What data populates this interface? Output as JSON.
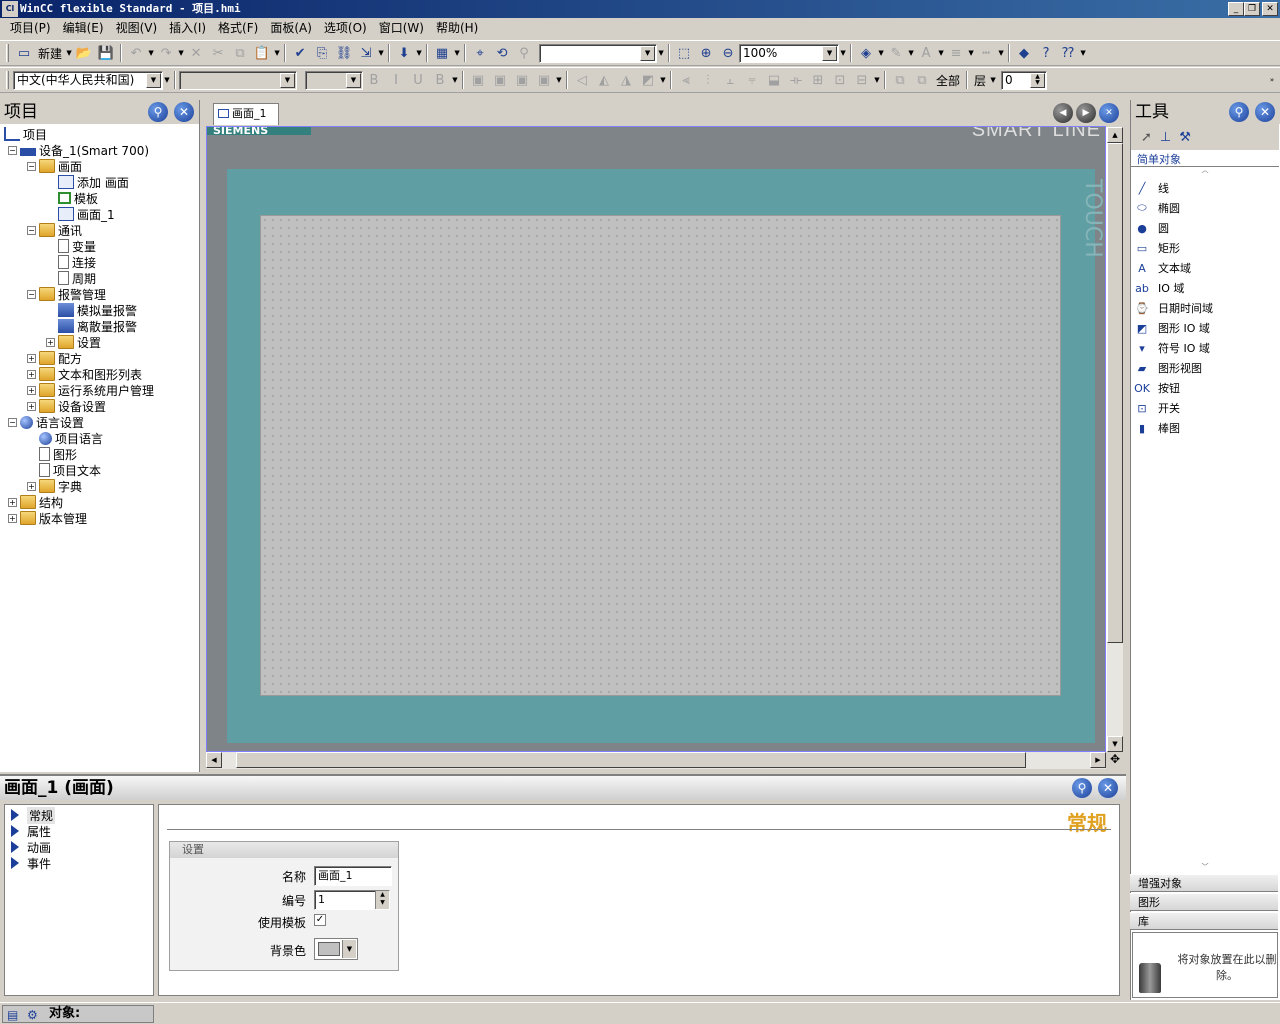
{
  "window": {
    "title": "WinCC flexible Standard - 项目.hmi",
    "icon_label": "Cl",
    "buttons": [
      "_",
      "❐",
      "✕"
    ]
  },
  "menu": [
    "项目(P)",
    "编辑(E)",
    "视图(V)",
    "插入(I)",
    "格式(F)",
    "面板(A)",
    "选项(O)",
    "窗口(W)",
    "帮助(H)"
  ],
  "toolbar1": {
    "new_label": "新建",
    "zoom_value": "100%"
  },
  "toolbar2": {
    "language": "中文(中华人民共和国)",
    "all_label": "全部",
    "layer_label": "层",
    "layer_value": "0"
  },
  "project_panel": {
    "title": "项目",
    "tree": [
      {
        "label": "项目",
        "level": 0,
        "icon": "project"
      },
      {
        "label": "设备_1(Smart 700)",
        "level": 1,
        "icon": "device",
        "toggle": "⊟"
      },
      {
        "label": "画面",
        "level": 2,
        "icon": "folder",
        "toggle": "⊟"
      },
      {
        "label": "添加 画面",
        "level": 3,
        "icon": "add"
      },
      {
        "label": "模板",
        "level": 3,
        "icon": "template"
      },
      {
        "label": "画面_1",
        "level": 3,
        "icon": "screen"
      },
      {
        "label": "通讯",
        "level": 2,
        "icon": "folder",
        "toggle": "⊟"
      },
      {
        "label": "变量",
        "level": 3,
        "icon": "doc"
      },
      {
        "label": "连接",
        "level": 3,
        "icon": "doc"
      },
      {
        "label": "周期",
        "level": 3,
        "icon": "doc"
      },
      {
        "label": "报警管理",
        "level": 2,
        "icon": "folder",
        "toggle": "⊟"
      },
      {
        "label": "模拟量报警",
        "level": 3,
        "icon": "alarm"
      },
      {
        "label": "离散量报警",
        "level": 3,
        "icon": "alarm"
      },
      {
        "label": "设置",
        "level": 3,
        "icon": "folder",
        "toggle": "⊞"
      },
      {
        "label": "配方",
        "level": 2,
        "icon": "folder",
        "toggle": "⊞"
      },
      {
        "label": "文本和图形列表",
        "level": 2,
        "icon": "folder",
        "toggle": "⊞"
      },
      {
        "label": "运行系统用户管理",
        "level": 2,
        "icon": "folder",
        "toggle": "⊞"
      },
      {
        "label": "设备设置",
        "level": 2,
        "icon": "folder",
        "toggle": "⊞"
      },
      {
        "label": "语言设置",
        "level": 1,
        "icon": "globe",
        "toggle": "⊟"
      },
      {
        "label": "项目语言",
        "level": 2,
        "icon": "globe"
      },
      {
        "label": "图形",
        "level": 2,
        "icon": "doc"
      },
      {
        "label": "项目文本",
        "level": 2,
        "icon": "doc"
      },
      {
        "label": "字典",
        "level": 2,
        "icon": "folder",
        "toggle": "⊞"
      },
      {
        "label": "结构",
        "level": 1,
        "icon": "folder",
        "toggle": "⊞"
      },
      {
        "label": "版本管理",
        "level": 1,
        "icon": "folder",
        "toggle": "⊞"
      }
    ]
  },
  "editor": {
    "tab_label": "画面_1",
    "bezel_text": "SIEMENS",
    "brand_text": "SMART LINE",
    "side_text": "TOUCH"
  },
  "tools_panel": {
    "title": "工具",
    "section_simple": "简单对象",
    "items": [
      {
        "label": "线",
        "icon": "line-icon"
      },
      {
        "label": "椭圆",
        "icon": "ellipse-icon"
      },
      {
        "label": "圆",
        "icon": "circle-icon"
      },
      {
        "label": "矩形",
        "icon": "rectangle-icon"
      },
      {
        "label": "文本域",
        "icon": "text-icon"
      },
      {
        "label": "IO 域",
        "icon": "io-field-icon"
      },
      {
        "label": "日期时间域",
        "icon": "datetime-icon"
      },
      {
        "label": "图形 IO 域",
        "icon": "graphic-io-icon"
      },
      {
        "label": "符号 IO 域",
        "icon": "symbolic-io-icon"
      },
      {
        "label": "图形视图",
        "icon": "graphic-view-icon"
      },
      {
        "label": "按钮",
        "icon": "button-icon"
      },
      {
        "label": "开关",
        "icon": "switch-icon"
      },
      {
        "label": "棒图",
        "icon": "bar-icon"
      }
    ],
    "section_enhanced": "增强对象",
    "section_graphics": "图形",
    "section_library": "库",
    "trash_text": "将对象放置在此以删除。"
  },
  "properties": {
    "title": "画面_1 (画面)",
    "nav": [
      "常规",
      "属性",
      "动画",
      "事件"
    ],
    "heading": "常规",
    "group_title": "设置",
    "name_label": "名称",
    "name_value": "画面_1",
    "number_label": "编号",
    "number_value": "1",
    "template_label": "使用模板",
    "template_checked": "✓",
    "bgcolor_label": "背景色",
    "bgcolor_value": "#c0c0c0"
  },
  "status": {
    "objects_label": "对象:"
  },
  "colors": {
    "titlebar": "#0a246a",
    "hmi_frame": "#5f9ea2",
    "accent_heading": "#e0a020"
  }
}
